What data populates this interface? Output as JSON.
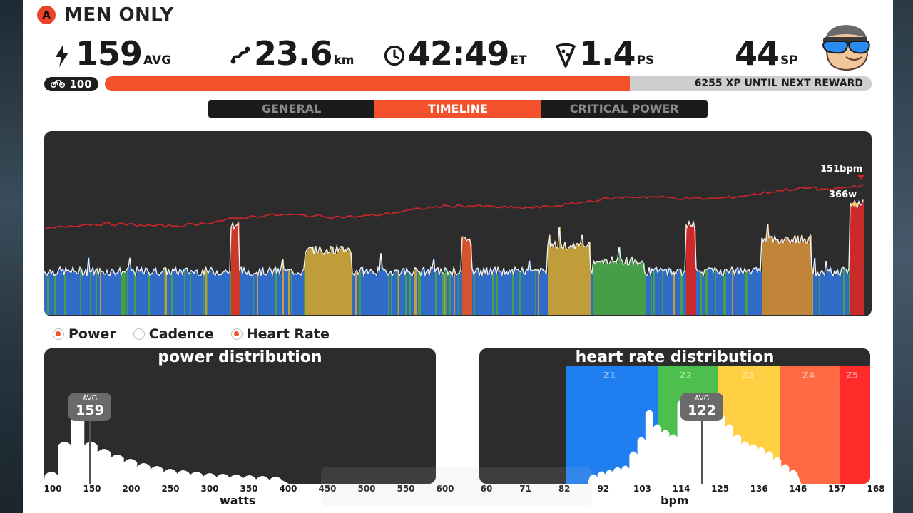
{
  "header": {
    "badge": "A",
    "title": "MEN ONLY"
  },
  "stats": {
    "power": {
      "value": "159",
      "unit": "AVG",
      "icon": "lightning-icon"
    },
    "distance": {
      "value": "23.6",
      "unit": "km",
      "icon": "route-icon"
    },
    "time": {
      "value": "42:49",
      "unit": "ET",
      "icon": "clock-icon"
    },
    "pizza": {
      "value": "1.4",
      "unit": "PS",
      "icon": "pizza-icon"
    },
    "sport_points": {
      "value": "44",
      "unit": "SP"
    }
  },
  "level": {
    "value": "100",
    "icon": "bike-icon"
  },
  "xp": {
    "text": "6255 XP UNTIL NEXT REWARD",
    "progress": 0.685
  },
  "tabs": [
    {
      "label": "GENERAL",
      "active": false
    },
    {
      "label": "TIMELINE",
      "active": true
    },
    {
      "label": "CRITICAL POWER",
      "active": false
    }
  ],
  "timeline": {
    "hr_label": "151bpm",
    "power_label": "366w"
  },
  "legend": [
    {
      "label": "Power",
      "checked": true
    },
    {
      "label": "Cadence",
      "checked": false
    },
    {
      "label": "Heart Rate",
      "checked": true
    }
  ],
  "power_dist": {
    "title": "power distribution",
    "avg_label": "AVG",
    "avg_value": "159",
    "xlabel": "watts",
    "ticks": [
      "100",
      "150",
      "200",
      "250",
      "300",
      "350",
      "400",
      "450",
      "500",
      "550",
      "600"
    ]
  },
  "hr_dist": {
    "title": "heart rate distribution",
    "avg_label": "AVG",
    "avg_value": "122",
    "xlabel": "bpm",
    "ticks": [
      "60",
      "71",
      "82",
      "92",
      "103",
      "114",
      "125",
      "136",
      "146",
      "157",
      "168"
    ],
    "zones": [
      {
        "label": "Z1",
        "color": "#1f7ff0"
      },
      {
        "label": "Z2",
        "color": "#4cbf4f"
      },
      {
        "label": "Z3",
        "color": "#ffcf44"
      },
      {
        "label": "Z4",
        "color": "#ff6a42"
      },
      {
        "label": "Z5",
        "color": "#ff2a2a"
      }
    ]
  },
  "colors": {
    "accent": "#f2512c",
    "panel_dark": "#2c2c2c",
    "hr_line": "#d0242b"
  }
}
